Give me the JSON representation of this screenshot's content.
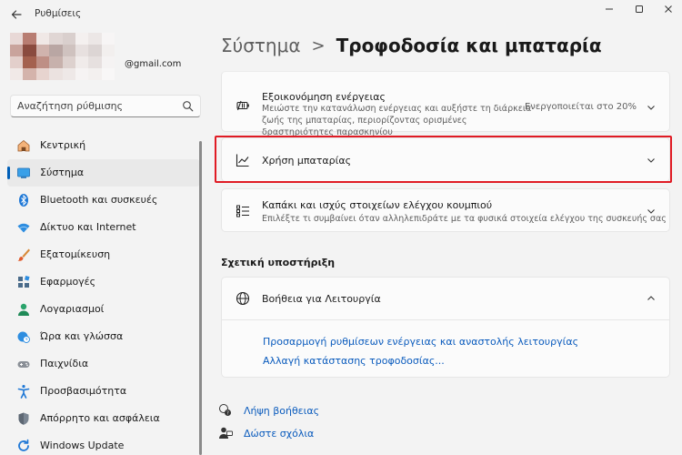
{
  "window": {
    "title": "Ρυθμίσεις"
  },
  "profile": {
    "email": "@gmail.com",
    "avatar_colors": [
      "#e8d8d6",
      "#b87d72",
      "#f0e8e6",
      "#e0d6d4",
      "#d9cfcd",
      "#f4f0ef",
      "#ece7e6",
      "#f7f5f5",
      "#c9a39c",
      "#8a4b3f",
      "#d0b3ad",
      "#b9a6a3",
      "#cfc2bf",
      "#e7e0df",
      "#dcd5d4",
      "#f2efee",
      "#e3cfcb",
      "#a4614f",
      "#be8f85",
      "#c7b1ac",
      "#ddd1ce",
      "#f0ebea",
      "#e6e0df",
      "#f5f3f3",
      "#f1e9e7",
      "#d4b3ab",
      "#e7d4cf",
      "#ebe2e0",
      "#eee8e7",
      "#f6f3f3",
      "#f3f0ef",
      "#f8f7f7"
    ]
  },
  "search": {
    "placeholder": "Αναζήτηση ρύθμισης"
  },
  "sidebar": {
    "items": [
      {
        "label": "Κεντρική",
        "icon": "home-icon"
      },
      {
        "label": "Σύστημα",
        "icon": "system-icon",
        "active": true
      },
      {
        "label": "Bluetooth και συσκευές",
        "icon": "bluetooth-icon"
      },
      {
        "label": "Δίκτυο και Internet",
        "icon": "network-icon"
      },
      {
        "label": "Εξατομίκευση",
        "icon": "brush-icon"
      },
      {
        "label": "Εφαρμογές",
        "icon": "apps-icon"
      },
      {
        "label": "Λογαριασμοί",
        "icon": "account-icon"
      },
      {
        "label": "Ώρα και γλώσσα",
        "icon": "clock-globe-icon"
      },
      {
        "label": "Παιχνίδια",
        "icon": "gamepad-icon"
      },
      {
        "label": "Προσβασιμότητα",
        "icon": "accessibility-icon"
      },
      {
        "label": "Απόρρητο και ασφάλεια",
        "icon": "shield-icon"
      },
      {
        "label": "Windows Update",
        "icon": "update-icon"
      }
    ]
  },
  "breadcrumb": {
    "parent": "Σύστημα",
    "separator": ">",
    "current": "Τροφοδοσία και μπαταρία"
  },
  "settings": {
    "energy_saver": {
      "title": "Εξοικονόμηση ενέργειας",
      "description": "Μειώστε την κατανάλωση ενέργειας και αυξήστε τη διάρκεια ζωής της μπαταρίας, περιορίζοντας ορισμένες δραστηριότητες παρασκηνίου",
      "value": "Ενεργοποιείται στο 20%"
    },
    "battery_usage": {
      "title": "Χρήση μπαταρίας"
    },
    "lid_power": {
      "title": "Καπάκι και ισχύς στοιχείων ελέγχου κουμπιού",
      "description": "Επιλέξτε τι συμβαίνει όταν αλληλεπιδράτε με τα φυσικά στοιχεία ελέγχου της συσκευής σας"
    }
  },
  "support": {
    "section_title": "Σχετική υποστήριξη",
    "help_title": "Βοήθεια για Λειτουργία",
    "links": [
      "Προσαρμογή ρυθμίσεων ενέργειας και αναστολής λειτουργίας",
      "Αλλαγή κατάστασης τροφοδοσίας..."
    ]
  },
  "footer": {
    "get_help": "Λήψη βοήθειας",
    "give_feedback": "Δώστε σχόλια"
  },
  "colors": {
    "accent": "#005fb8",
    "link": "#0a5bbd",
    "highlight": "#e01b24"
  }
}
